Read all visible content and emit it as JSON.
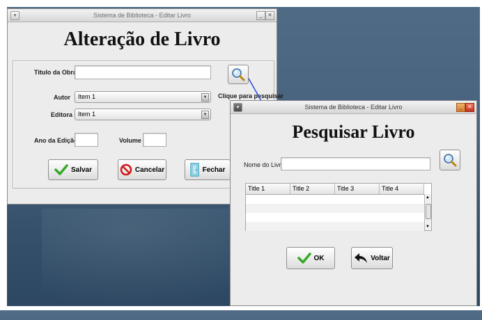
{
  "editor_window": {
    "title": "Sistema de Biblioteca - Editar Livro",
    "heading": "Alteração de Livro",
    "fields": {
      "titulo_label": "Titulo da Obra",
      "titulo_value": "",
      "autor_label": "Autor",
      "autor_value": "Item 1",
      "editora_label": "Editora",
      "editora_value": "Item 1",
      "ano_label": "Ano da Edição",
      "ano_value": "",
      "volume_label": "Volume",
      "volume_value": ""
    },
    "search_hint": "Clique para pesquisar",
    "buttons": {
      "salvar": "Salvar",
      "cancelar": "Cancelar",
      "fechar": "Fechar"
    }
  },
  "search_window": {
    "title": "Sistema de Biblioteca - Editar Livro",
    "heading": "Pesquisar Livro",
    "nome_label": "Nome do Livro",
    "nome_value": "",
    "table": {
      "columns": [
        "Title 1",
        "Title 2",
        "Title 3",
        "Title 4"
      ]
    },
    "buttons": {
      "ok": "OK",
      "voltar": "Voltar"
    }
  },
  "icons": [
    "menu-icon",
    "minimize-icon",
    "close-icon",
    "magnifier-icon",
    "checkmark-icon",
    "cancel-icon",
    "door-icon",
    "back-arrow-icon"
  ],
  "colors": {
    "desktop": "#46627d",
    "window_bg": "#ececec",
    "close_button": "#d9442a",
    "accent_arrow": "#1f3fd6"
  }
}
